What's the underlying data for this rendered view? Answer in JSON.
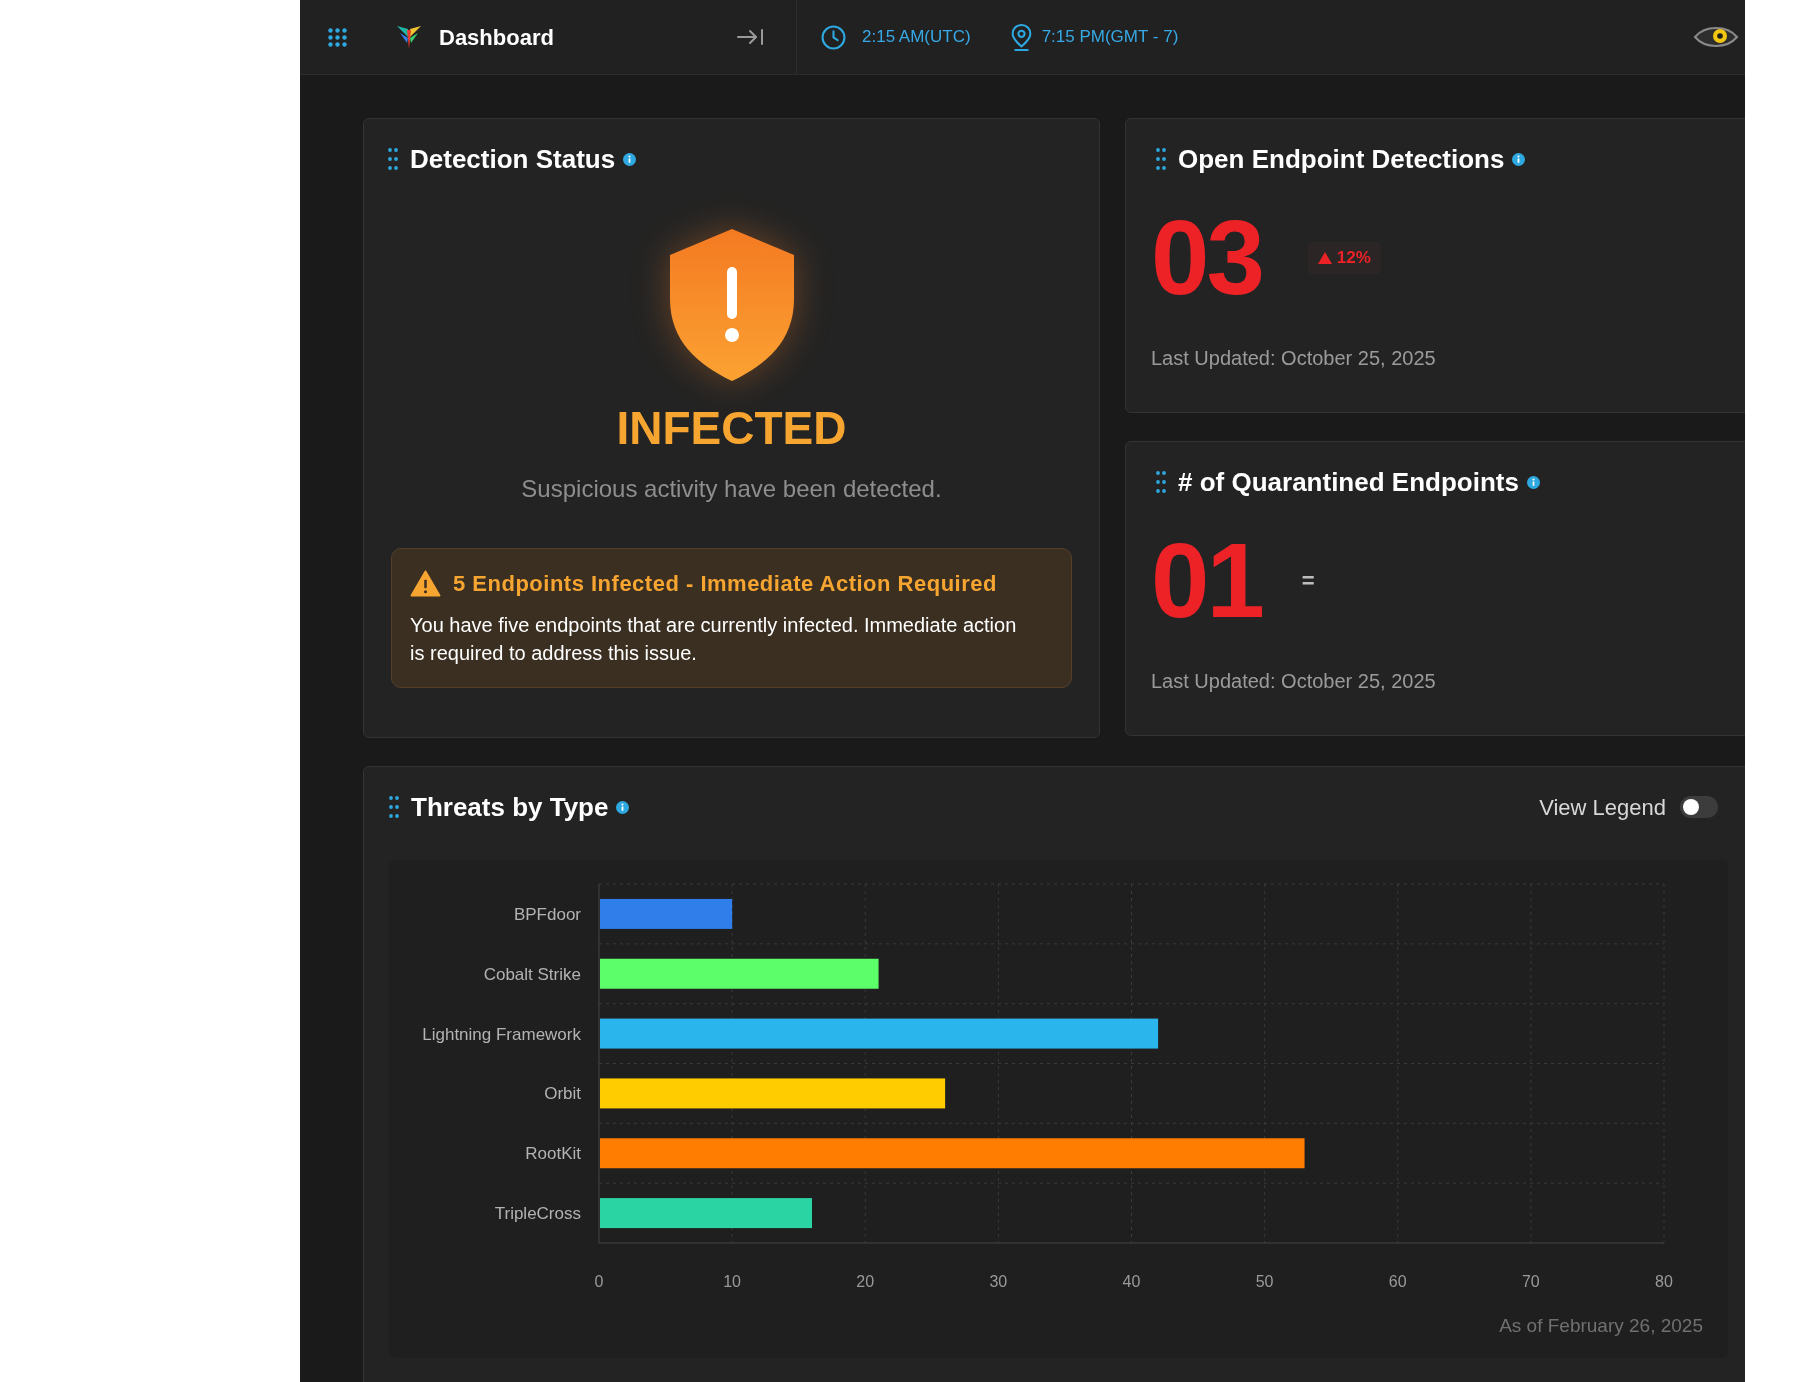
{
  "app_bar": {
    "title": "Dashboard",
    "utc_time": "2:15 AM(UTC)",
    "local_time": "7:15 PM(GMT - 7)"
  },
  "detection_status": {
    "title": "Detection Status",
    "status": {
      "kind": "infected",
      "label": "INFECTED",
      "message": "Suspicious activity have been detected."
    },
    "alert": {
      "kind": "warning",
      "title": "5 Endpoints Infected - Immediate Action Required",
      "body": "You have five endpoints that are currently infected. Immediate action is required to address this issue."
    }
  },
  "metric_cards": [
    {
      "title": "Open Endpoint Detections",
      "value": "03",
      "trend": {
        "kind": "up",
        "text": "12%"
      },
      "updated": "Last Updated: October 25, 2025"
    },
    {
      "title": "# of Quarantined Endpoints",
      "value": "01",
      "trend": {
        "kind": "flat",
        "text": "="
      },
      "updated": "Last Updated: October 25, 2025"
    }
  ],
  "threats_by_type": {
    "title": "Threats by Type",
    "view_legend": {
      "label": "View Legend",
      "on": false
    },
    "chart_data": {
      "type": "bar",
      "orientation": "horizontal",
      "grid": true,
      "categories": [
        "BPFdoor",
        "Cobalt Strike",
        "Lightning Framework",
        "Orbit",
        "RootKit",
        "TripleCross"
      ],
      "series": [
        {
          "values": [
            10,
            21,
            42,
            26,
            53,
            16
          ],
          "colors": [
            "#2f7eea",
            "#5cff6a",
            "#2ab5ec",
            "#ffcc00",
            "#ff7d00",
            "#2bd4a3"
          ]
        }
      ],
      "xlim": [
        0,
        80
      ],
      "xticks": [
        0,
        10,
        20,
        30,
        40,
        50,
        60,
        70,
        80
      ]
    },
    "footnote": "As of February 26, 2025"
  }
}
